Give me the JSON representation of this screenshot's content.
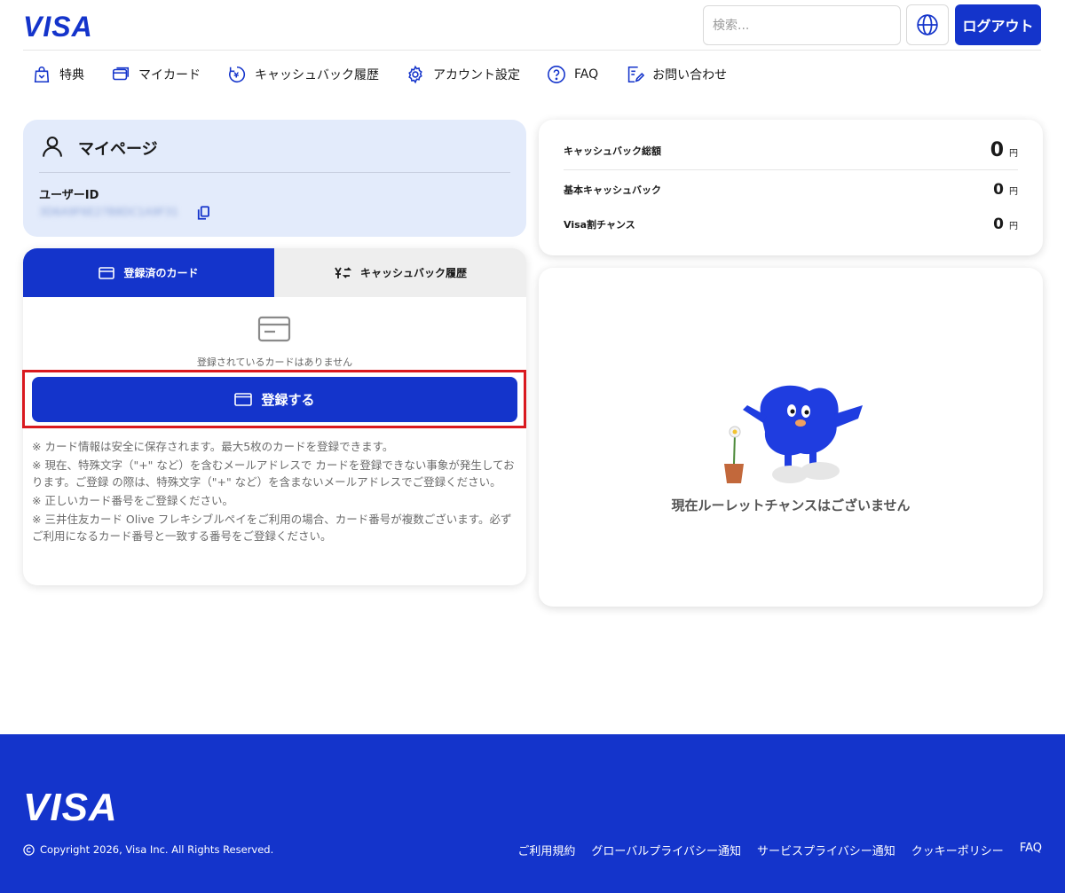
{
  "header": {
    "logo": "VISA",
    "search_placeholder": "検索...",
    "logout_label": "ログアウト"
  },
  "nav": [
    {
      "label": "特典",
      "icon": "gift-bag-icon"
    },
    {
      "label": "マイカード",
      "icon": "card-icon"
    },
    {
      "label": "キャッシュバック履歴",
      "icon": "cashback-history-icon"
    },
    {
      "label": "アカウント設定",
      "icon": "gear-icon"
    },
    {
      "label": "FAQ",
      "icon": "question-icon"
    },
    {
      "label": "お問い合わせ",
      "icon": "contact-form-icon"
    }
  ],
  "mypage": {
    "title": "マイページ",
    "user_id_label": "ユーザーID",
    "user_id_value": "3D6A9F6E27B8DC1A9F31"
  },
  "cards": {
    "tab_registered": "登録済のカード",
    "tab_history": "キャッシュバック履歴",
    "empty_text": "登録されているカードはありません",
    "register_label": "登録する",
    "notes": [
      "※ カード情報は安全に保存されます。最大5枚のカードを登録できます。",
      "※ 現在、特殊文字（\"+\" など）を含むメールアドレスで カードを登録できない事象が発生しております。ご登録 の際は、特殊文字（\"+\" など）を含まないメールアドレスでご登録ください。",
      "※ 正しいカード番号をご登録ください。",
      "※ 三井住友カード Olive フレキシブルペイをご利用の場合、カード番号が複数ございます。必ずご利用になるカード番号と一致する番号をご登録ください。"
    ]
  },
  "cashback": {
    "total_label": "キャッシュバック総額",
    "total_value": "0",
    "basic_label": "基本キャッシュバック",
    "basic_value": "0",
    "visa_label": "Visa割チャンス",
    "visa_value": "0",
    "unit": "円"
  },
  "roulette": {
    "empty_text": "現在ルーレットチャンスはございません"
  },
  "footer": {
    "logo": "VISA",
    "copyright": "Copyright 2026, Visa Inc. All Rights Reserved.",
    "links": [
      "ご利用規約",
      "グローバルプライバシー通知",
      "サービスプライバシー通知",
      "クッキーポリシー",
      "FAQ"
    ]
  },
  "colors": {
    "brand": "#1434cb",
    "highlight": "#d9191f",
    "mypage_bg": "#e3ebfb"
  }
}
